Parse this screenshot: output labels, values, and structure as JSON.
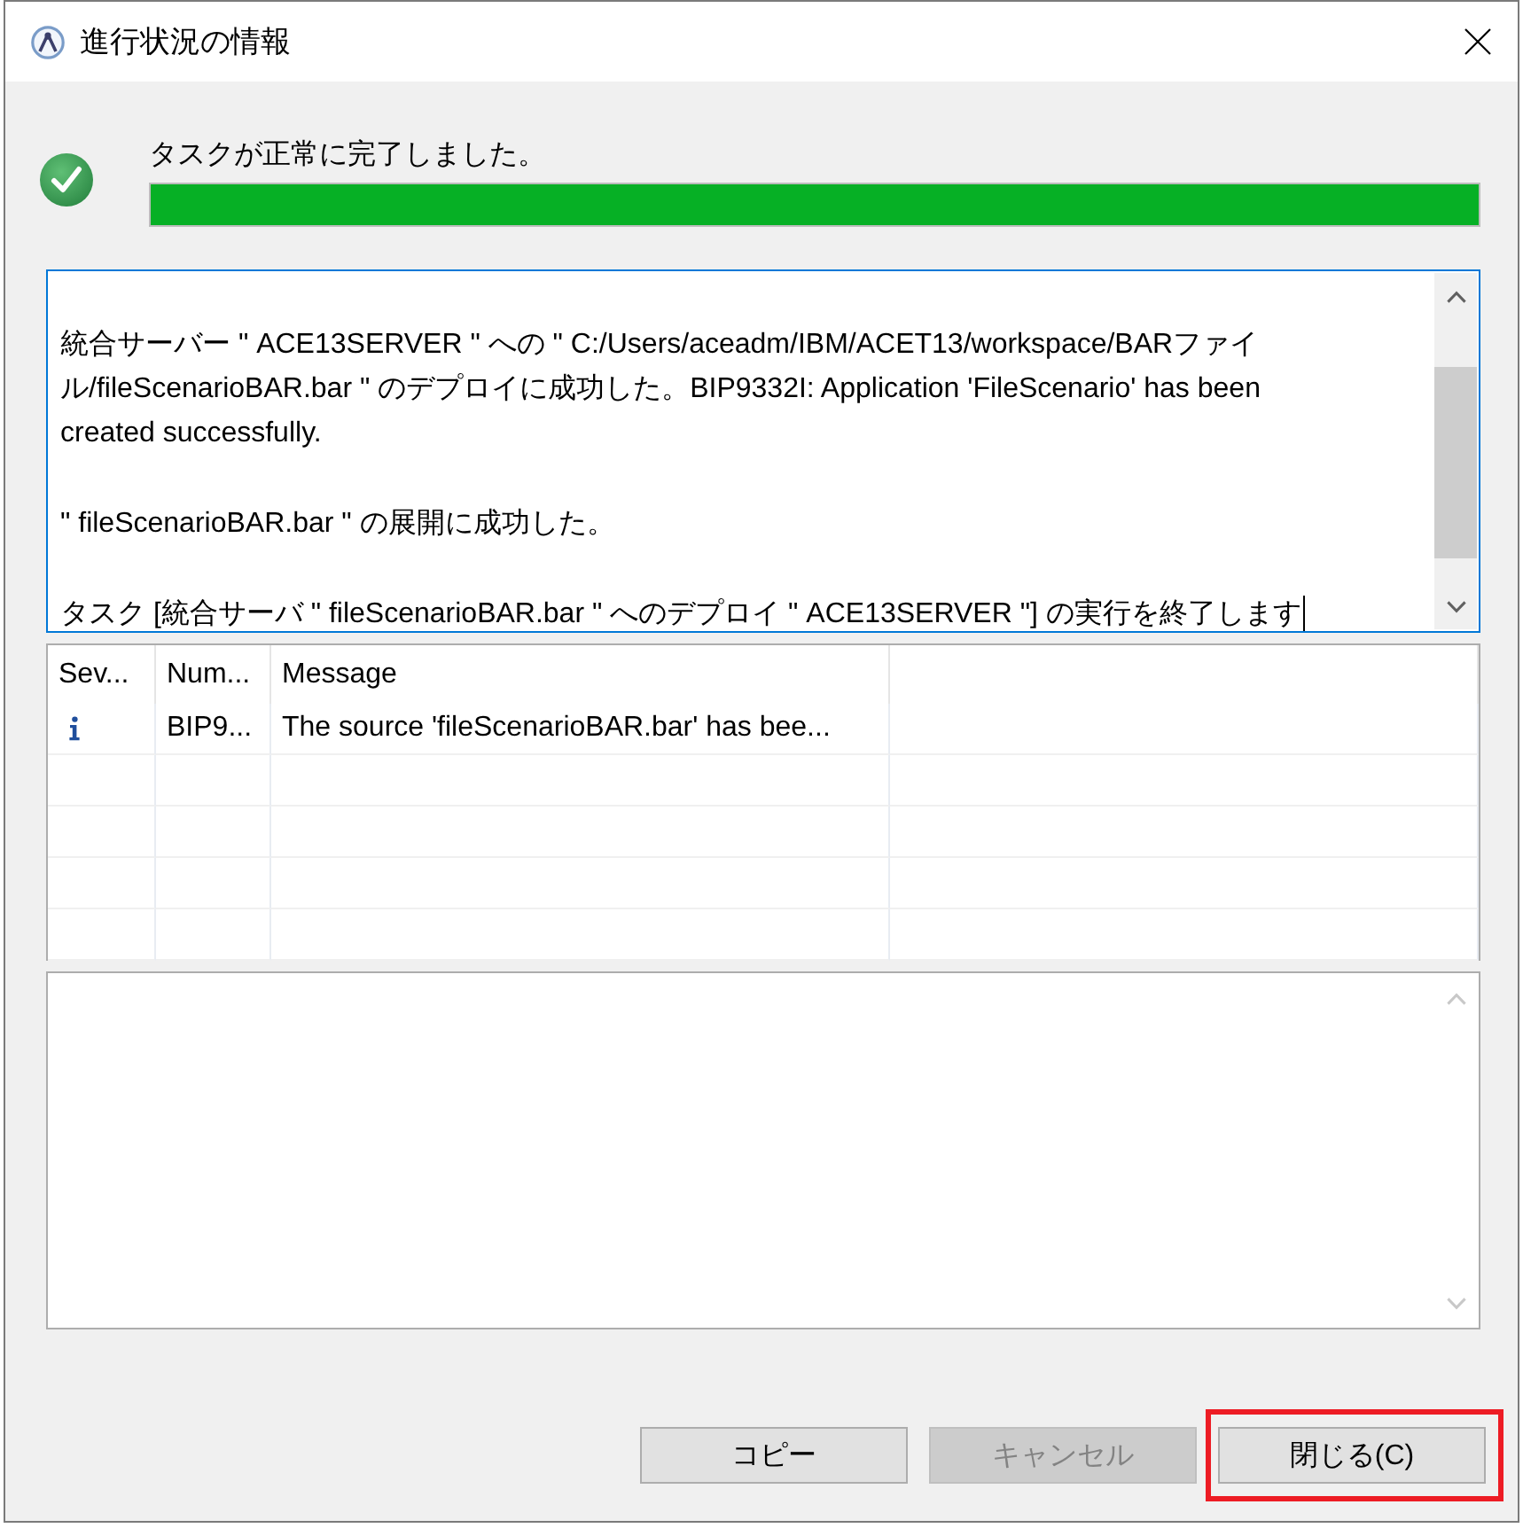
{
  "window": {
    "title": "進行状況の情報"
  },
  "status": {
    "kind": "success",
    "message": "タスクが正常に完了しました。"
  },
  "progress": {
    "level": 1
  },
  "log": {
    "focused": true,
    "paragraphs": [
      {
        "lines": [
          "統合サーバー \" ACE13SERVER \" への \" C:/Users/aceadm/IBM/ACET13/workspace/BARファイ",
          "ル/fileScenarioBAR.bar \" のデプロイに成功した。BIP9332I: Application 'FileScenario' has been",
          "created successfully."
        ]
      },
      {
        "lines": [
          "\" fileScenarioBAR.bar \" の展開に成功した。"
        ]
      },
      {
        "lines": [
          "タスク [統合サーバ \" fileScenarioBAR.bar \" へのデプロイ \" ACE13SERVER \"] の実行を終了します"
        ]
      }
    ]
  },
  "messages_table": {
    "columns": [
      "Sev...",
      "Num...",
      "Message"
    ],
    "rows": [
      {
        "kind": "info",
        "number": "BIP9...",
        "message": "The source 'fileScenarioBAR.bar' has bee..."
      }
    ]
  },
  "buttons": [
    {
      "label": "コピー",
      "disabled": false,
      "highlighted": false
    },
    {
      "label": "キャンセル",
      "disabled": true,
      "highlighted": false
    },
    {
      "label": "閉じる(C)",
      "disabled": false,
      "highlighted": true
    }
  ]
}
